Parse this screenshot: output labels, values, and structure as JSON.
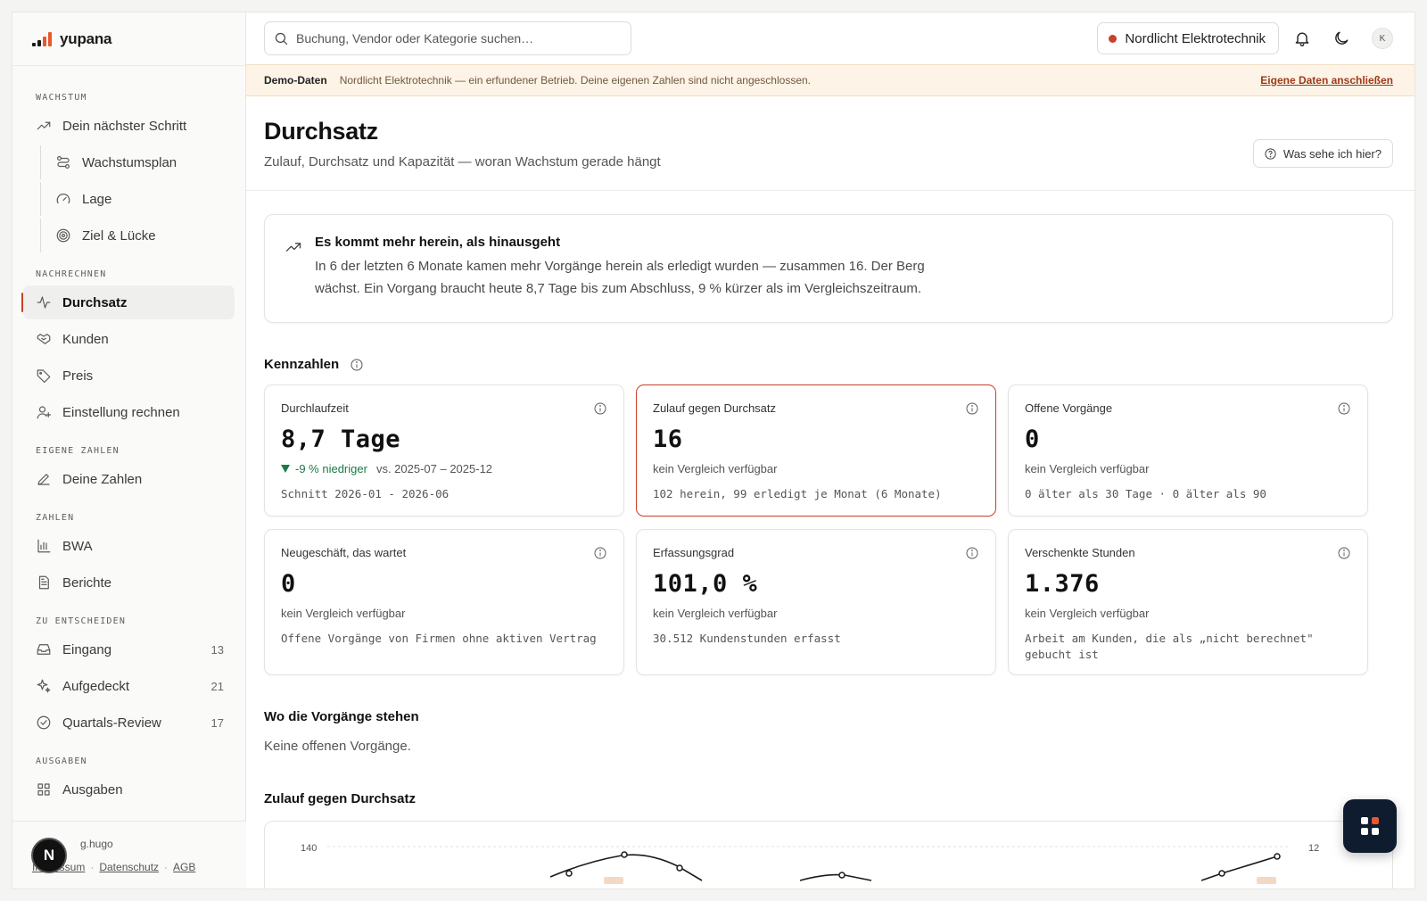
{
  "brand": {
    "name": "yupana",
    "logo_colors": [
      "#1a1a1a",
      "#1a1a1a",
      "#e8572e",
      "#e8572e"
    ]
  },
  "sidebar": {
    "sections": [
      {
        "label": "WACHSTUM",
        "items": [
          {
            "label": "Dein nächster Schritt",
            "icon": "trending-up-icon"
          },
          {
            "label": "Wachstumsplan",
            "icon": "route-icon",
            "sub": true
          },
          {
            "label": "Lage",
            "icon": "gauge-icon",
            "sub": true
          },
          {
            "label": "Ziel & Lücke",
            "icon": "target-icon",
            "sub": true
          }
        ]
      },
      {
        "label": "NACHRECHNEN",
        "items": [
          {
            "label": "Durchsatz",
            "icon": "activity-icon",
            "active": true
          },
          {
            "label": "Kunden",
            "icon": "handshake-icon"
          },
          {
            "label": "Preis",
            "icon": "tag-icon"
          },
          {
            "label": "Einstellung rechnen",
            "icon": "user-plus-icon"
          }
        ]
      },
      {
        "label": "EIGENE ZAHLEN",
        "items": [
          {
            "label": "Deine Zahlen",
            "icon": "pencil-icon"
          }
        ]
      },
      {
        "label": "ZAHLEN",
        "items": [
          {
            "label": "BWA",
            "icon": "bar-chart-icon"
          },
          {
            "label": "Berichte",
            "icon": "file-text-icon"
          }
        ]
      },
      {
        "label": "ZU ENTSCHEIDEN",
        "items": [
          {
            "label": "Eingang",
            "icon": "inbox-icon",
            "count": "13"
          },
          {
            "label": "Aufgedeckt",
            "icon": "sparkles-icon",
            "count": "21"
          },
          {
            "label": "Quartals-Review",
            "icon": "check-circle-icon",
            "count": "17"
          }
        ]
      },
      {
        "label": "AUSGABEN",
        "items": [
          {
            "label": "Ausgaben",
            "icon": "grid-icon"
          }
        ]
      }
    ],
    "footer": {
      "user": "g.hugo",
      "links": [
        "Impressum",
        "Datenschutz",
        "AGB"
      ],
      "badge": "N"
    }
  },
  "topbar": {
    "search_placeholder": "Buchung, Vendor oder Kategorie suchen…",
    "company": "Nordlicht Elektrotechnik",
    "company_status_color": "#c8412b",
    "avatar": "K"
  },
  "banner": {
    "label": "Demo-Daten",
    "text": "Nordlicht Elektrotechnik — ein erfundener Betrieb. Deine eigenen Zahlen sind nicht angeschlossen.",
    "link": "Eigene Daten anschließen"
  },
  "page": {
    "title": "Durchsatz",
    "subtitle": "Zulauf, Durchsatz und Kapazität — woran Wachstum gerade hängt",
    "help": "Was sehe ich hier?"
  },
  "insight": {
    "title": "Es kommt mehr herein, als hinausgeht",
    "text": "In 6 der letzten 6 Monate kamen mehr Vorgänge herein als erledigt wurden — zusammen 16. Der Berg wächst. Ein Vorgang braucht heute 8,7 Tage bis zum Abschluss, 9 % kürzer als im Vergleichszeitraum."
  },
  "kpis": {
    "title": "Kennzahlen",
    "cards": [
      {
        "label": "Durchlaufzeit",
        "value": "8,7 Tage",
        "delta": "-9 % niedriger",
        "delta_ref": "vs. 2025-07 – 2025-12",
        "note": "Schnitt 2026-01 - 2026-06"
      },
      {
        "label": "Zulauf gegen Durchsatz",
        "value": "16",
        "delta_ref": "kein Vergleich verfügbar",
        "note": "102 herein, 99 erledigt je Monat (6 Monate)",
        "highlight": true
      },
      {
        "label": "Offene Vorgänge",
        "value": "0",
        "delta_ref": "kein Vergleich verfügbar",
        "note": "0 älter als 30 Tage · 0 älter als 90"
      },
      {
        "label": "Neugeschäft, das wartet",
        "value": "0",
        "delta_ref": "kein Vergleich verfügbar",
        "note": "Offene Vorgänge von Firmen ohne aktiven Vertrag"
      },
      {
        "label": "Erfassungsgrad",
        "value": "101,0 %",
        "delta_ref": "kein Vergleich verfügbar",
        "note": "30.512 Kundenstunden erfasst"
      },
      {
        "label": "Verschenkte Stunden",
        "value": "1.376",
        "delta_ref": "kein Vergleich verfügbar",
        "note": "Arbeit am Kunden, die als „nicht berechnet\" gebucht ist"
      }
    ]
  },
  "status_section": {
    "title": "Wo die Vorgänge stehen",
    "text": "Keine offenen Vorgänge."
  },
  "chart_section": {
    "title": "Zulauf gegen Durchsatz"
  },
  "chart_data": {
    "type": "line",
    "ytick_left": "140",
    "ytick_right": "12",
    "grid": true
  },
  "colors": {
    "accent": "#c8412b",
    "positive": "#1b7a45",
    "banner_bg": "#fdf3e6"
  }
}
